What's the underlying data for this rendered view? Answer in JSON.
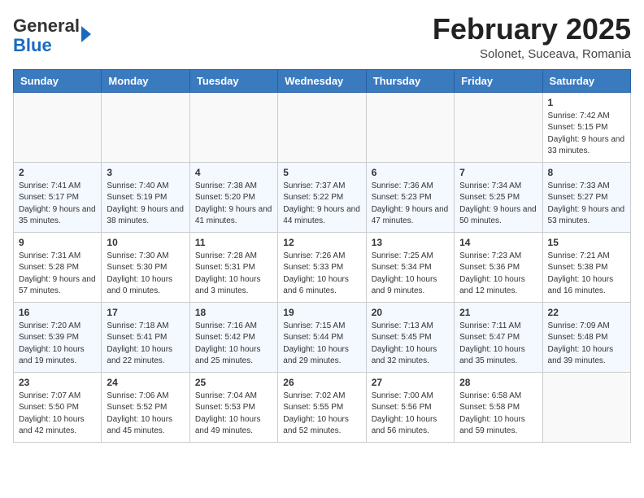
{
  "header": {
    "logo_line1": "General",
    "logo_line2": "Blue",
    "month_title": "February 2025",
    "location": "Solonet, Suceava, Romania"
  },
  "weekdays": [
    "Sunday",
    "Monday",
    "Tuesday",
    "Wednesday",
    "Thursday",
    "Friday",
    "Saturday"
  ],
  "weeks": [
    [
      {
        "day": "",
        "info": ""
      },
      {
        "day": "",
        "info": ""
      },
      {
        "day": "",
        "info": ""
      },
      {
        "day": "",
        "info": ""
      },
      {
        "day": "",
        "info": ""
      },
      {
        "day": "",
        "info": ""
      },
      {
        "day": "1",
        "info": "Sunrise: 7:42 AM\nSunset: 5:15 PM\nDaylight: 9 hours and 33 minutes."
      }
    ],
    [
      {
        "day": "2",
        "info": "Sunrise: 7:41 AM\nSunset: 5:17 PM\nDaylight: 9 hours and 35 minutes."
      },
      {
        "day": "3",
        "info": "Sunrise: 7:40 AM\nSunset: 5:19 PM\nDaylight: 9 hours and 38 minutes."
      },
      {
        "day": "4",
        "info": "Sunrise: 7:38 AM\nSunset: 5:20 PM\nDaylight: 9 hours and 41 minutes."
      },
      {
        "day": "5",
        "info": "Sunrise: 7:37 AM\nSunset: 5:22 PM\nDaylight: 9 hours and 44 minutes."
      },
      {
        "day": "6",
        "info": "Sunrise: 7:36 AM\nSunset: 5:23 PM\nDaylight: 9 hours and 47 minutes."
      },
      {
        "day": "7",
        "info": "Sunrise: 7:34 AM\nSunset: 5:25 PM\nDaylight: 9 hours and 50 minutes."
      },
      {
        "day": "8",
        "info": "Sunrise: 7:33 AM\nSunset: 5:27 PM\nDaylight: 9 hours and 53 minutes."
      }
    ],
    [
      {
        "day": "9",
        "info": "Sunrise: 7:31 AM\nSunset: 5:28 PM\nDaylight: 9 hours and 57 minutes."
      },
      {
        "day": "10",
        "info": "Sunrise: 7:30 AM\nSunset: 5:30 PM\nDaylight: 10 hours and 0 minutes."
      },
      {
        "day": "11",
        "info": "Sunrise: 7:28 AM\nSunset: 5:31 PM\nDaylight: 10 hours and 3 minutes."
      },
      {
        "day": "12",
        "info": "Sunrise: 7:26 AM\nSunset: 5:33 PM\nDaylight: 10 hours and 6 minutes."
      },
      {
        "day": "13",
        "info": "Sunrise: 7:25 AM\nSunset: 5:34 PM\nDaylight: 10 hours and 9 minutes."
      },
      {
        "day": "14",
        "info": "Sunrise: 7:23 AM\nSunset: 5:36 PM\nDaylight: 10 hours and 12 minutes."
      },
      {
        "day": "15",
        "info": "Sunrise: 7:21 AM\nSunset: 5:38 PM\nDaylight: 10 hours and 16 minutes."
      }
    ],
    [
      {
        "day": "16",
        "info": "Sunrise: 7:20 AM\nSunset: 5:39 PM\nDaylight: 10 hours and 19 minutes."
      },
      {
        "day": "17",
        "info": "Sunrise: 7:18 AM\nSunset: 5:41 PM\nDaylight: 10 hours and 22 minutes."
      },
      {
        "day": "18",
        "info": "Sunrise: 7:16 AM\nSunset: 5:42 PM\nDaylight: 10 hours and 25 minutes."
      },
      {
        "day": "19",
        "info": "Sunrise: 7:15 AM\nSunset: 5:44 PM\nDaylight: 10 hours and 29 minutes."
      },
      {
        "day": "20",
        "info": "Sunrise: 7:13 AM\nSunset: 5:45 PM\nDaylight: 10 hours and 32 minutes."
      },
      {
        "day": "21",
        "info": "Sunrise: 7:11 AM\nSunset: 5:47 PM\nDaylight: 10 hours and 35 minutes."
      },
      {
        "day": "22",
        "info": "Sunrise: 7:09 AM\nSunset: 5:48 PM\nDaylight: 10 hours and 39 minutes."
      }
    ],
    [
      {
        "day": "23",
        "info": "Sunrise: 7:07 AM\nSunset: 5:50 PM\nDaylight: 10 hours and 42 minutes."
      },
      {
        "day": "24",
        "info": "Sunrise: 7:06 AM\nSunset: 5:52 PM\nDaylight: 10 hours and 45 minutes."
      },
      {
        "day": "25",
        "info": "Sunrise: 7:04 AM\nSunset: 5:53 PM\nDaylight: 10 hours and 49 minutes."
      },
      {
        "day": "26",
        "info": "Sunrise: 7:02 AM\nSunset: 5:55 PM\nDaylight: 10 hours and 52 minutes."
      },
      {
        "day": "27",
        "info": "Sunrise: 7:00 AM\nSunset: 5:56 PM\nDaylight: 10 hours and 56 minutes."
      },
      {
        "day": "28",
        "info": "Sunrise: 6:58 AM\nSunset: 5:58 PM\nDaylight: 10 hours and 59 minutes."
      },
      {
        "day": "",
        "info": ""
      }
    ]
  ]
}
